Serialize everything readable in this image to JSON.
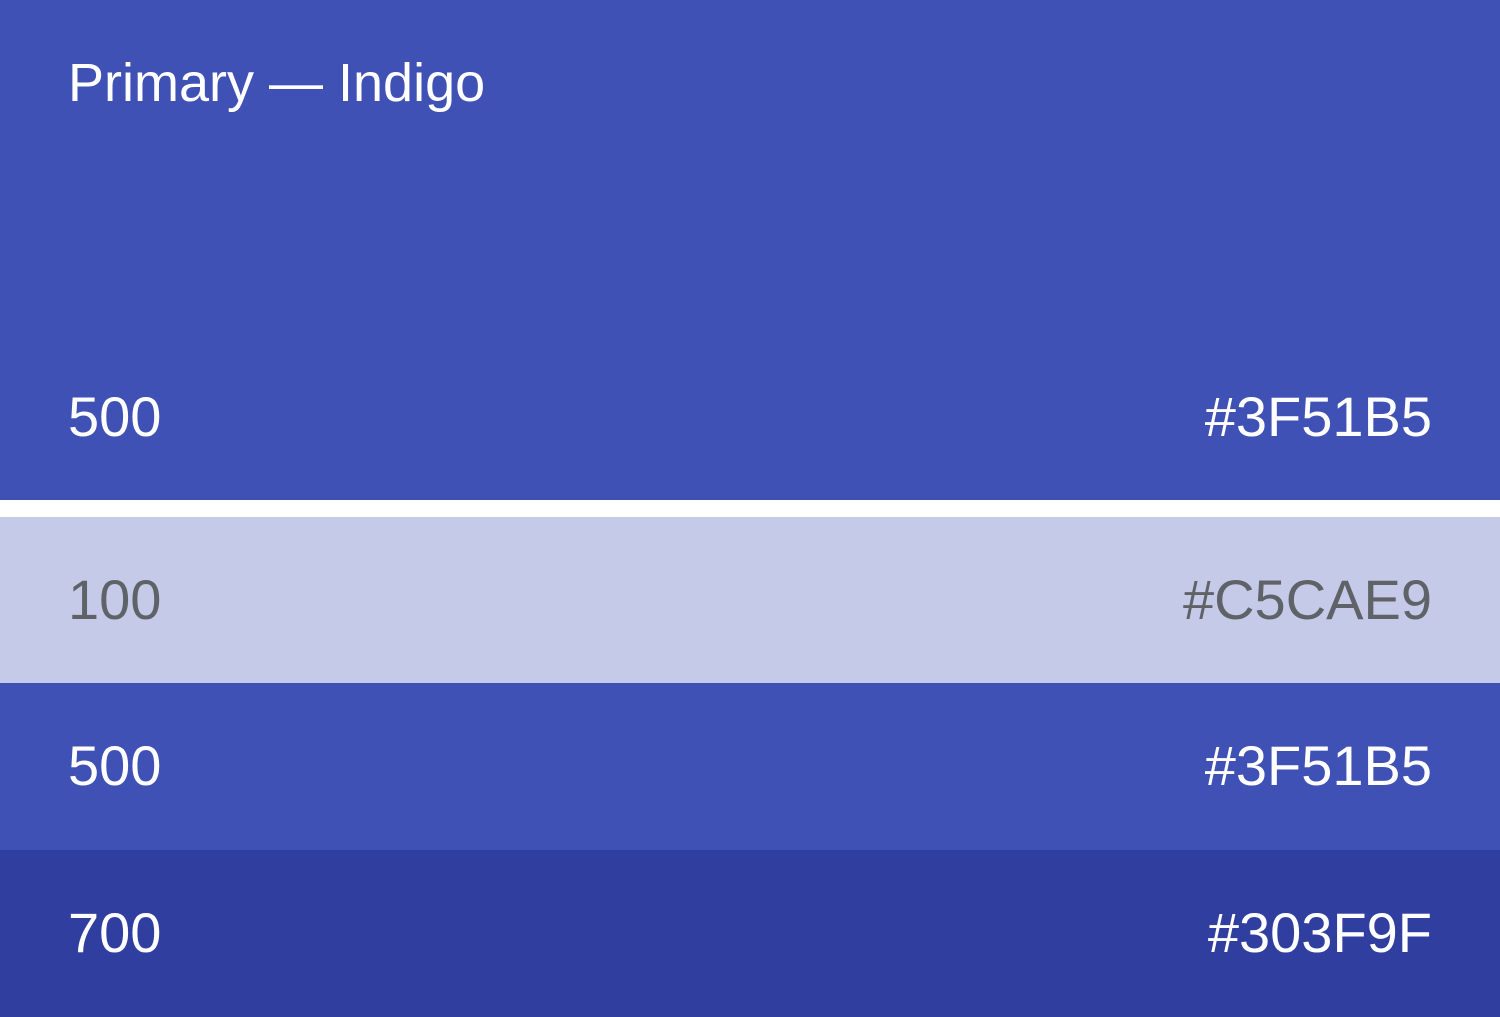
{
  "palette": {
    "title": "Primary — Indigo",
    "hero": {
      "shade": "500",
      "hex": "#3F51B5",
      "background": "#3F51B5",
      "text_color": "#FFFFFF"
    },
    "rows": [
      {
        "shade": "100",
        "hex": "#C5CAE9",
        "background": "#C5CAE9",
        "text_color": "#5F6368"
      },
      {
        "shade": "500",
        "hex": "#3F51B5",
        "background": "#3F51B5",
        "text_color": "#FFFFFF"
      },
      {
        "shade": "700",
        "hex": "#303F9F",
        "background": "#303F9F",
        "text_color": "#FFFFFF"
      }
    ]
  }
}
